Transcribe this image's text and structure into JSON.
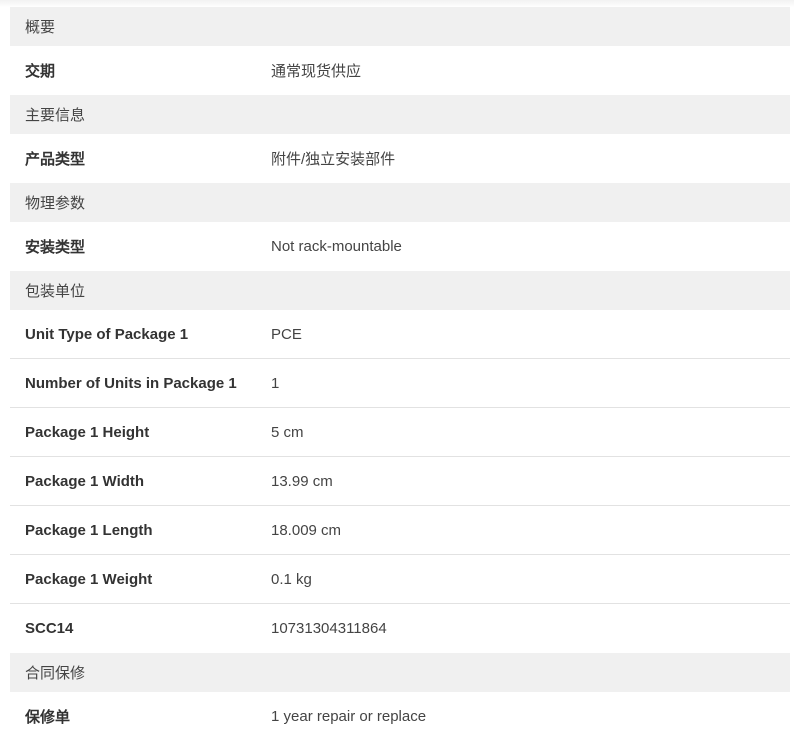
{
  "sections": [
    {
      "header": "概要",
      "rows": [
        {
          "label": "交期",
          "value": "通常现货供应"
        }
      ]
    },
    {
      "header": "主要信息",
      "rows": [
        {
          "label": "产品类型",
          "value": "附件/独立安装部件"
        }
      ]
    },
    {
      "header": "物理参数",
      "rows": [
        {
          "label": "安装类型",
          "value": "Not rack-mountable"
        }
      ]
    },
    {
      "header": "包装单位",
      "rows": [
        {
          "label": "Unit Type of Package 1",
          "value": "PCE"
        },
        {
          "label": "Number of Units in Package 1",
          "value": "1"
        },
        {
          "label": "Package 1 Height",
          "value": "5 cm"
        },
        {
          "label": "Package 1 Width",
          "value": "13.99 cm"
        },
        {
          "label": "Package 1 Length",
          "value": "18.009 cm"
        },
        {
          "label": "Package 1 Weight",
          "value": "0.1 kg"
        },
        {
          "label": "SCC14",
          "value": "10731304311864"
        }
      ]
    },
    {
      "header": "合同保修",
      "rows": [
        {
          "label": "保修单",
          "value": "1 year repair or replace"
        }
      ]
    }
  ]
}
